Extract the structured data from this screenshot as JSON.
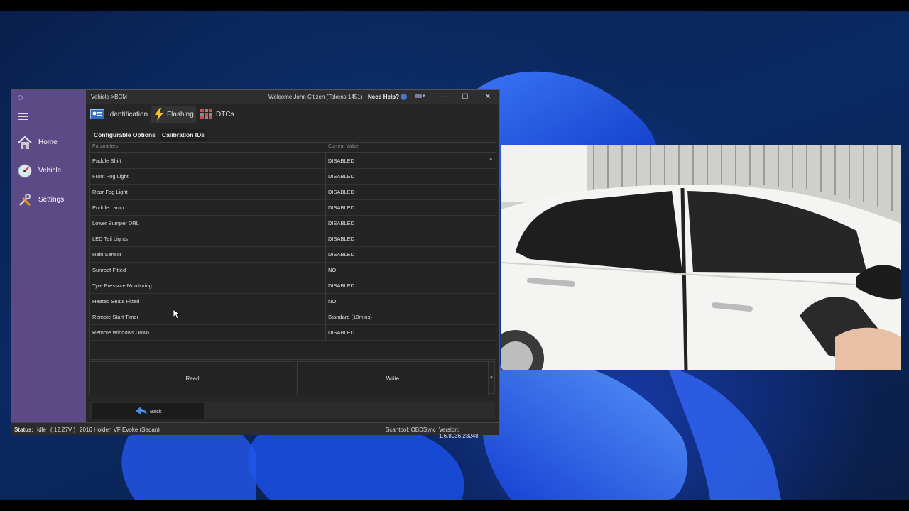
{
  "window": {
    "breadcrumb": "Vehicle->BCM",
    "welcome": "Welcome John Citizen (Tokens 1451)",
    "help": "Need Help?",
    "minimize": "—",
    "maximize": "☐",
    "close": "✕"
  },
  "sidebar": {
    "items": [
      {
        "label": "Home",
        "icon": "home-icon"
      },
      {
        "label": "Vehicle",
        "icon": "gauge-icon"
      },
      {
        "label": "Settings",
        "icon": "tools-icon"
      }
    ]
  },
  "tabs": [
    {
      "label": "Identification",
      "icon": "id-card-icon"
    },
    {
      "label": "Flashing",
      "icon": "lightning-icon",
      "active": true
    },
    {
      "label": "DTCs",
      "icon": "grid-icon"
    }
  ],
  "subtabs": [
    {
      "label": "Configurable Options",
      "active": true
    },
    {
      "label": "Calibration IDs"
    }
  ],
  "grid": {
    "headers": [
      "Parameters",
      "Current Value"
    ],
    "rows": [
      {
        "param": "Paddle Shift",
        "value": "DISABLED"
      },
      {
        "param": "Front Fog Light",
        "value": "DISABLED"
      },
      {
        "param": "Rear Fog Light",
        "value": "DISABLED"
      },
      {
        "param": "Puddle Lamp",
        "value": "DISABLED"
      },
      {
        "param": "Lower Bumper DRL",
        "value": "DISABLED"
      },
      {
        "param": "LED Tail Lights",
        "value": "DISABLED"
      },
      {
        "param": "Rain Sensor",
        "value": "DISABLED"
      },
      {
        "param": "Sunroof Fitted",
        "value": "NO"
      },
      {
        "param": "Tyre Pressure Monitoring",
        "value": "DISABLED"
      },
      {
        "param": "Heated Seats Fitted",
        "value": "NO"
      },
      {
        "param": "Remote Start Timer",
        "value": "Standard (10mins)"
      },
      {
        "param": "Remote Windows Down",
        "value": "DISABLED"
      }
    ]
  },
  "actions": {
    "read": "Read",
    "write": "Write",
    "back": "Back"
  },
  "status": {
    "label": "Status:",
    "state": "Idle",
    "voltage": "( 12.27V )",
    "vehicle": "2016 Holden VF Evoke (Sedan)",
    "scantool": "Scantool: OBDSync",
    "version": "Version: 1.6.8936.23248"
  },
  "colors": {
    "sidebar": "#5b4a86",
    "panel": "#262626",
    "accent": "#4a90e2"
  }
}
